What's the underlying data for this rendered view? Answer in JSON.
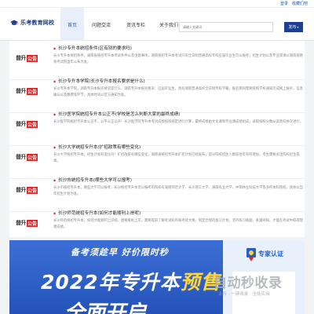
{
  "top_links": {
    "login": "登录",
    "favorite": "收藏们吧"
  },
  "header": {
    "logo_text": "乐考教育网校",
    "nav": [
      {
        "label": "首页",
        "active": true
      },
      {
        "label": "问题交流",
        "active": false
      },
      {
        "label": "资讯专栏",
        "active": false
      },
      {
        "label": "关于我们",
        "active": false
      }
    ],
    "search_placeholder": "请输入关键词",
    "post_button": "发布"
  },
  "articles": [
    {
      "badge_main": "普升",
      "badge_tag": "公告",
      "title": "长沙专升本统招条件(区有别的要求吗)",
      "excerpt": "长沙专升本统招条件，湖南省统招专升本考试条件以及注意事项，湖南统招专升本考试只有全日制普通高校专科应届毕业生可以报考，招生计划以及专业等请以湖南省教育考试院当年公布为准。"
    },
    {
      "badge_main": "普升",
      "badge_tag": "公告",
      "title": "长沙专升本学院(长沙专升本报名要求是什么)",
      "excerpt": "长沙专升本学院，湖南专升本报名要求是什么，湖南专升本报名要求：应届毕业生，具有湖南普通高校全日制专科学籍，报名期间需要按照学校通知完成网上报名、信息确认以及缴费等环节，具体时间以官方通知为准。"
    },
    {
      "badge_main": "普升",
      "badge_tag": "公告",
      "title": "长沙医学院统招专升本公正不(学校是怎么判断大家的最终成绩)",
      "excerpt": "长沙医学院统招专升本公正不，公平公正公开！长沙医学院专升本考试成绩按照规定进行计算，最终成绩由文化课和专业课成绩组成，录取按照分数从高到低依次进行。"
    },
    {
      "badge_main": "普升",
      "badge_tag": "公告",
      "title": "长沙大学统招专升本(扩招政策有哪些变化)",
      "excerpt": "长沙大学统招专升本，招生计划有变化吗？扩招政策有哪些变化，湖南省统招专升本扩招计划已经发布，部分院校招生人数较往年有所增加，考生需要关注院校招生简章。"
    },
    {
      "badge_main": "普升",
      "badge_tag": "公告",
      "title": "长沙市统招专升本(哪些大学可以报考)",
      "excerpt": "长沙市统招专升本，哪些大学可以报考，长沙统招专升本可以报考的院校有湖南师范大学、长沙理工大学、湖南农业大学、中南林业科技大学等多所本科院校，具体以当年招生计划为准。"
    },
    {
      "badge_main": "普升",
      "badge_tag": "公告",
      "title": "长沙师范统招专升本(如何才能顺利上岸呢)",
      "excerpt": "长沙师范统招专升本，如何才能顺利上岸呢，想要顺利上岸，需要提前了解考试科目和考试大纲，制定合理的复习计划，坚持练习真题，查漏补缺，才能在考试中取得理想成绩。"
    }
  ],
  "banner": {
    "subtitle": "备考须趁早 好价限时秒",
    "headline_a": "2022年专升本",
    "headline_b": "预售",
    "bottom": "全面开启",
    "side_label": "专家认证"
  },
  "watermark": {
    "main": "自动秒收录",
    "sub": "上传 · 一键收录 · 全能实用"
  },
  "colors": {
    "brand": "#1d3f93",
    "accent_red": "#e02424",
    "nav_active_bg": "#e9eefb",
    "banner_blue": "#2a5bc1",
    "highlight_yellow": "#ffd63a"
  }
}
